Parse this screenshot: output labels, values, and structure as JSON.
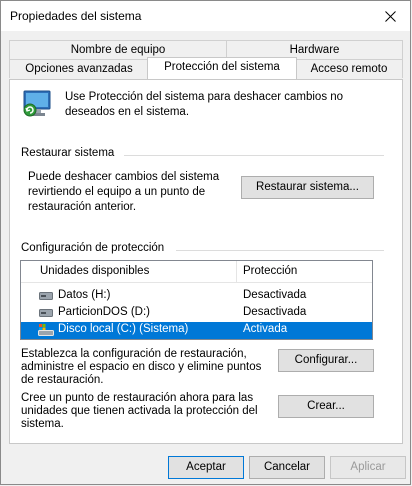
{
  "window": {
    "title": "Propiedades del sistema"
  },
  "tabs": {
    "row1": [
      "Nombre de equipo",
      "Hardware"
    ],
    "row2": [
      "Opciones avanzadas",
      "Protección del sistema",
      "Acceso remoto"
    ],
    "active": "Protección del sistema"
  },
  "intro": {
    "text": "Use Protección del sistema para deshacer cambios no deseados en el sistema."
  },
  "restore": {
    "section_title": "Restaurar sistema",
    "description": "Puede deshacer cambios del sistema revirtiendo el equipo a un punto de restauración anterior.",
    "button": "Restaurar sistema..."
  },
  "protection": {
    "section_title": "Configuración de protección",
    "columns": [
      "Unidades disponibles",
      "Protección"
    ],
    "drives": [
      {
        "name": "Datos (H:)",
        "protection": "Desactivada",
        "icon": "drive-icon",
        "selected": false
      },
      {
        "name": "ParticionDOS (D:)",
        "protection": "Desactivada",
        "icon": "drive-icon",
        "selected": false
      },
      {
        "name": "Disco local (C:) (Sistema)",
        "protection": "Activada",
        "icon": "system-drive-icon",
        "selected": true
      }
    ],
    "configure_text": "Establezca la configuración de restauración, administre el espacio en disco y elimine puntos de restauración.",
    "configure_button": "Configurar...",
    "create_text": "Cree un punto de restauración ahora para las unidades que tienen activada la protección del sistema.",
    "create_button": "Crear..."
  },
  "footer": {
    "ok": "Aceptar",
    "cancel": "Cancelar",
    "apply": "Aplicar"
  },
  "colors": {
    "accent": "#0078d7",
    "selected_row": "#0078d7",
    "disabled_text": "#9a9a9a"
  }
}
